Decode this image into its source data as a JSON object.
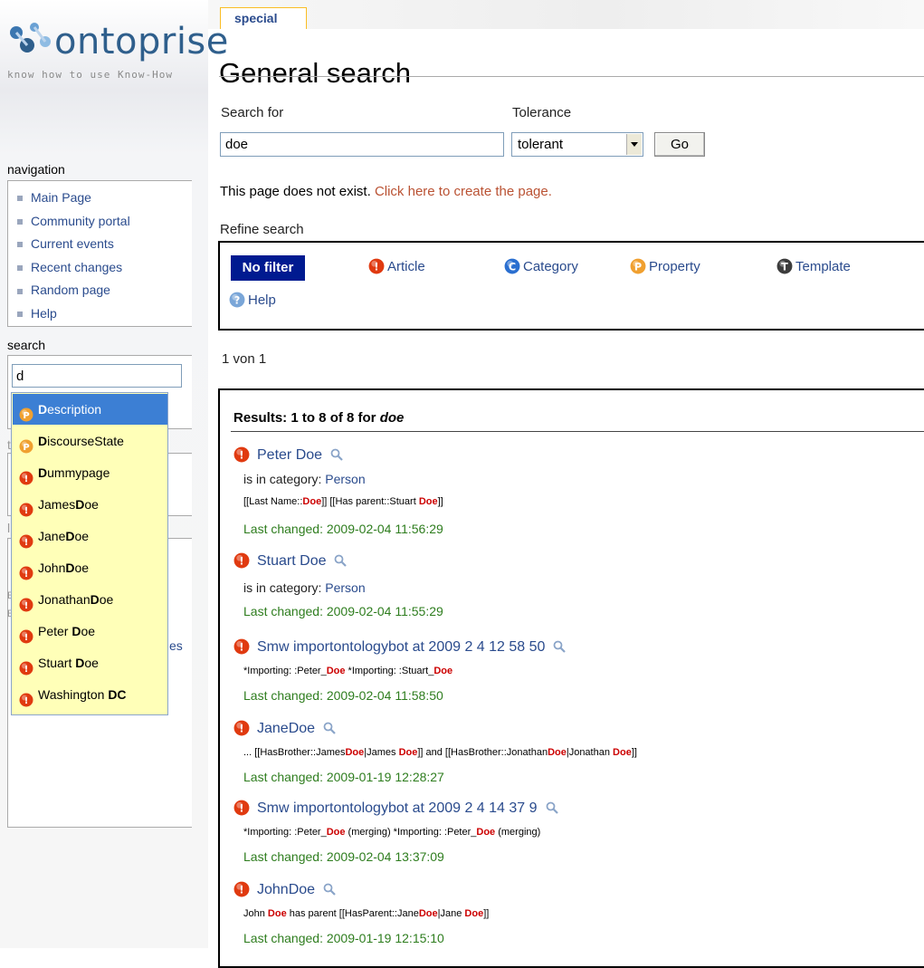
{
  "colors": {
    "link": "#2a4b8d",
    "new_link": "#ba5233",
    "highlight": "#cc0000",
    "date_green": "#2e7d1e",
    "nofilter_bg": "#001a90",
    "suggest_bg": "#ffffb8",
    "suggest_active": "#3c7fd4"
  },
  "logo": {
    "word": "ontoprise",
    "tagline": "know how to use Know-How"
  },
  "tab": {
    "label": "special"
  },
  "page_title": "General search",
  "sidebar": {
    "navigation_title": "navigation",
    "nav_items": [
      {
        "label": "Main Page"
      },
      {
        "label": "Community portal"
      },
      {
        "label": "Current events"
      },
      {
        "label": "Recent changes"
      },
      {
        "label": "Random page"
      },
      {
        "label": "Help"
      }
    ],
    "search_title": "search",
    "search_value": "d",
    "ghost_t": "t",
    "ghost_l": "l",
    "ghost_e1": "E",
    "ghost_e2": "E",
    "ghost_es": "es"
  },
  "suggestions": [
    {
      "type": "property",
      "icon": "property-icon",
      "bold": "D",
      "rest": "escription",
      "active": true
    },
    {
      "type": "property",
      "icon": "property-icon",
      "bold": "D",
      "rest": "iscourseState"
    },
    {
      "type": "article",
      "icon": "article-icon",
      "bold": "D",
      "rest": "ummypage"
    },
    {
      "type": "article",
      "icon": "article-icon",
      "pre": "James",
      "bold": "D",
      "rest": "oe"
    },
    {
      "type": "article",
      "icon": "article-icon",
      "pre": "Jane",
      "bold": "D",
      "rest": "oe"
    },
    {
      "type": "article",
      "icon": "article-icon",
      "pre": "John",
      "bold": "D",
      "rest": "oe"
    },
    {
      "type": "article",
      "icon": "article-icon",
      "pre": "Jonathan",
      "bold": "D",
      "rest": "oe"
    },
    {
      "type": "article",
      "icon": "article-icon",
      "pre": "Peter ",
      "bold": "D",
      "rest": "oe"
    },
    {
      "type": "article",
      "icon": "article-icon",
      "pre": "Stuart ",
      "bold": "D",
      "rest": "oe"
    },
    {
      "type": "article",
      "icon": "article-icon",
      "pre": "Washington ",
      "bold": "DC",
      "rest": ""
    }
  ],
  "search_form": {
    "search_for_label": "Search for",
    "search_for_value": "doe",
    "tolerance_label": "Tolerance",
    "tolerance_value": "tolerant",
    "go_label": "Go"
  },
  "notice": {
    "text": "This page does not exist. ",
    "link": "Click here to create the page."
  },
  "refine": {
    "title": "Refine search",
    "no_filter": "No filter",
    "filters": [
      {
        "label": "Article",
        "icon": "article-icon"
      },
      {
        "label": "Category",
        "icon": "category-icon"
      },
      {
        "label": "Property",
        "icon": "property-icon"
      },
      {
        "label": "Template",
        "icon": "template-icon"
      },
      {
        "label": "Help",
        "icon": "help-icon"
      }
    ]
  },
  "paging": {
    "text": "1 von 1"
  },
  "results": {
    "heading_prefix": "Results: 1 to 8 of 8 for ",
    "heading_term": "doe",
    "items": [
      {
        "title": "Peter Doe",
        "category_label": "is in category: ",
        "category": "Person",
        "snippet": [
          [
            "[[Last Name::",
            false
          ],
          [
            "Doe",
            true
          ],
          [
            "]] [[Has parent::Stuart ",
            false
          ],
          [
            "Doe",
            true
          ],
          [
            "]]",
            false
          ]
        ],
        "date": "Last changed: 2009-02-04 11:56:29"
      },
      {
        "title": "Stuart Doe",
        "category_label": "is in category: ",
        "category": "Person",
        "date": "Last changed: 2009-02-04 11:55:29"
      },
      {
        "title": "Smw importontologybot at 2009 2 4 12 58 50",
        "snippet": [
          [
            "*Importing: :Peter_",
            false
          ],
          [
            "Doe",
            true
          ],
          [
            " *Importing: :Stuart_",
            false
          ],
          [
            "Doe",
            true
          ]
        ],
        "date": "Last changed: 2009-02-04 11:58:50"
      },
      {
        "title": "JaneDoe",
        "snippet": [
          [
            "... [[HasBrother::James",
            false
          ],
          [
            "Doe",
            true
          ],
          [
            "|James ",
            false
          ],
          [
            "Doe",
            true
          ],
          [
            "]] and [[HasBrother::Jonathan",
            false
          ],
          [
            "Doe",
            true
          ],
          [
            "|Jonathan ",
            false
          ],
          [
            "Doe",
            true
          ],
          [
            "]]",
            false
          ]
        ],
        "date": "Last changed: 2009-01-19 12:28:27"
      },
      {
        "title": "Smw importontologybot at 2009 2 4 14 37 9",
        "snippet": [
          [
            "*Importing: :Peter_",
            false
          ],
          [
            "Doe",
            true
          ],
          [
            " (merging) *Importing: :Peter_",
            false
          ],
          [
            "Doe",
            true
          ],
          [
            " (merging)",
            false
          ]
        ],
        "date": "Last changed: 2009-02-04 13:37:09"
      },
      {
        "title": "JohnDoe",
        "snippet": [
          [
            "John ",
            false
          ],
          [
            "Doe",
            true
          ],
          [
            " has parent [[HasParent::Jane",
            false
          ],
          [
            "Doe",
            true
          ],
          [
            "|Jane ",
            false
          ],
          [
            "Doe",
            true
          ],
          [
            "]]",
            false
          ]
        ],
        "date": "Last changed: 2009-01-19 12:15:10"
      }
    ]
  }
}
